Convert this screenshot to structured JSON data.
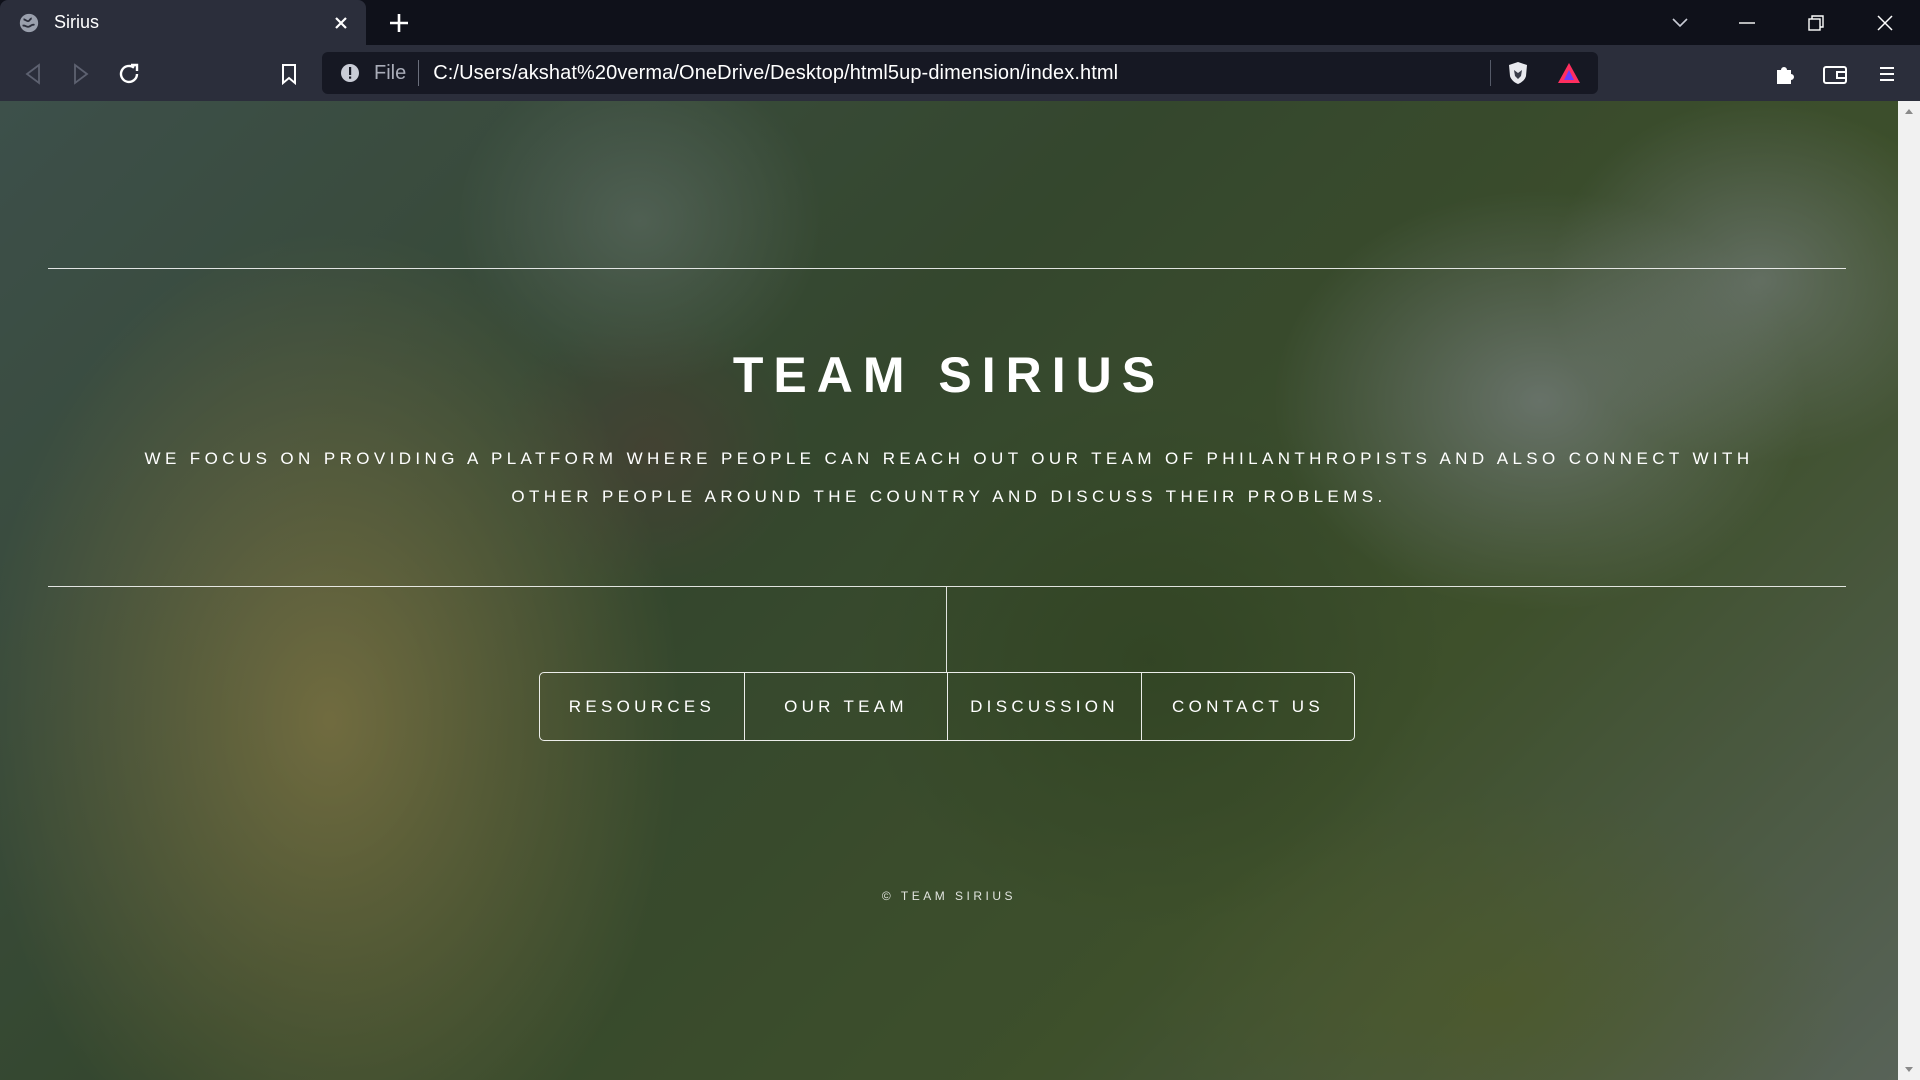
{
  "browser": {
    "tab_title": "Sirius",
    "url_scheme": "File",
    "url": "C:/Users/akshat%20verma/OneDrive/Desktop/html5up-dimension/index.html"
  },
  "page": {
    "title": "TEAM SIRIUS",
    "tagline": "We focus on providing a platform where people can reach out our team of philanthropists and also connect with other people around the country and discuss their problems.",
    "nav": [
      "RESOURCES",
      "OUR TEAM",
      "DISCUSSION",
      "CONTACT US"
    ],
    "footer": "© TEAM SIRIUS"
  },
  "colors": {
    "chrome_bg": "#0f111a",
    "toolbar_bg": "#2b2e3b",
    "urlbar_bg": "#161823",
    "text": "#ffffff"
  }
}
